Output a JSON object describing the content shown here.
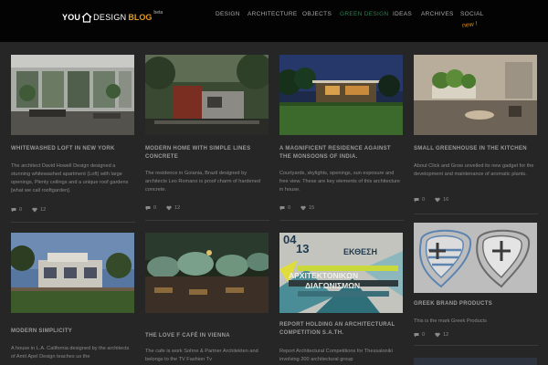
{
  "logo": {
    "you": "YOU",
    "design": "DESIGN",
    "blog": "BLOG",
    "beta": "beta"
  },
  "nav": [
    "DESIGN",
    "ARCHITECTURE",
    "OBJECTS",
    "GREEN DESIGN",
    "IDEAS",
    "ARCHIVES",
    "SOCIAL"
  ],
  "nav_active": "GREEN DESIGN",
  "new_tag": "new !",
  "colors": {
    "accent_orange": "#e39a1e",
    "active_green": "#2f7f4f",
    "background": "#262626",
    "topbar": "#030303"
  },
  "posts": [
    {
      "title": "WHITEWASHED LOFT IN NEW YORK",
      "excerpt": "The architect David Howell Design designed a stunning whitewashed apartment (Loft) with large openings, Plenty ceilings and a unique roof gardens [what we call rooftgarden].",
      "comments": "0",
      "likes": "12"
    },
    {
      "title": "MODERN HOME WITH SIMPLE LINES CONCRETE",
      "excerpt": "The residence in Goiania, Brazil designed by architects Leo Romano is proof charm of hardened concrete.",
      "comments": "0",
      "likes": "12"
    },
    {
      "title": "A MAGNIFICENT RESIDENCE AGAINST THE MONSOONS OF INDIA.",
      "excerpt": "Courtyards, skylights, openings, sun exposure and free view. These are key elements of this architecture in house.",
      "comments": "0",
      "likes": "15"
    },
    {
      "title": "SMALL GREENHOUSE IN THE KITCHEN",
      "excerpt": "About Click and Grow unveiled its new gadget for the development and maintenance of aromatic plants.",
      "comments": "0",
      "likes": "16"
    },
    {
      "title": "MODERN SIMPLICITY",
      "excerpt": "A house in L.A. California designed by the architects of Amit Apel Design teaches us the",
      "comments": "",
      "likes": ""
    },
    {
      "title": "THE LOVE F CAFÉ IN VIENNA",
      "excerpt": "The cafe is work Sohne & Partner Architekten and belongs to the TV Fashion Tv",
      "comments": "",
      "likes": ""
    },
    {
      "title": "REPORT HOLDING AN ARCHITECTURAL COMPETITION S.A.TH.",
      "excerpt": "Report Architectural Competitions for Thessaloniki involving 200 architectural group",
      "comments": "",
      "likes": ""
    },
    {
      "title": "GREEK BRAND PRODUCTS",
      "excerpt": "This is the mark Greek Products",
      "comments": "0",
      "likes": "12"
    }
  ],
  "poster": {
    "line1": "04",
    "line2": "13",
    "word1": "ΕΚΘΕΣΗ",
    "word2": "ΑΡΧΙΤΕΚΤΟΝΙΚΩΝ",
    "word3": "ΔΙΑΓΩΝΙΣΜΩΝ"
  },
  "icons": {
    "comments": "comment-bubble-icon",
    "likes": "heart-icon",
    "logo": "house-outline-icon"
  }
}
